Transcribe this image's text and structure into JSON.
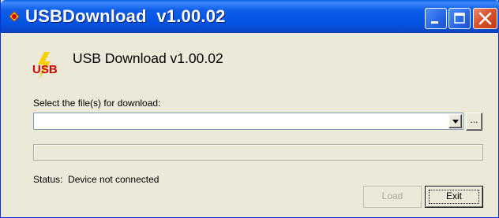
{
  "window": {
    "title": "USBDownload  v1.00.02",
    "icon": "usb-app-icon",
    "controls": [
      "minimize-icon",
      "maximize-icon",
      "close-icon"
    ]
  },
  "header": {
    "logo_text": "USB",
    "title": "USB Download v1.00.02"
  },
  "file_select": {
    "label": "Select the file(s) for download:",
    "value": "",
    "browse_label": "..."
  },
  "progress": {
    "value": 0
  },
  "status": {
    "text": "Status:  Device not connected"
  },
  "buttons": {
    "load_label": "Load",
    "load_enabled": false,
    "exit_label": "Exit"
  },
  "colors": {
    "title_bar": "#0a5ee8",
    "close_button": "#d9542d",
    "window_bg": "#ece9d8",
    "logo_red": "#d00000",
    "logo_yellow": "#f5d000"
  }
}
